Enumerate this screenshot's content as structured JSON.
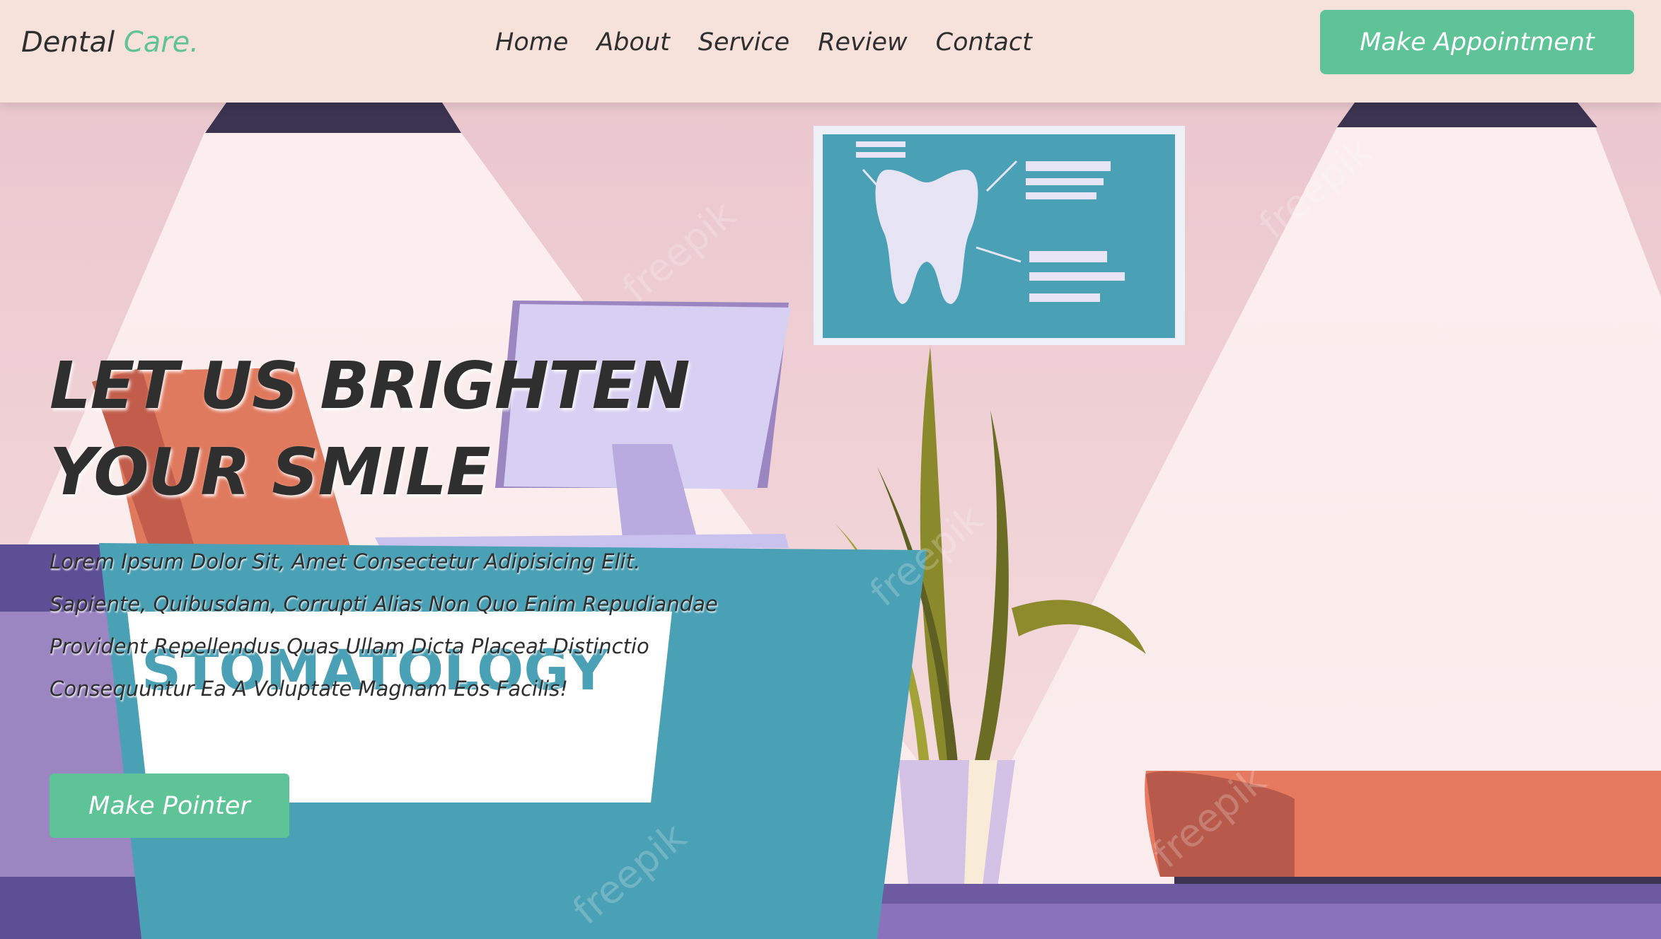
{
  "header": {
    "logo_primary": "Dental",
    "logo_accent": "Care.",
    "nav": [
      "Home",
      "About",
      "Service",
      "Review",
      "Contact"
    ],
    "cta_label": "Make Appointment"
  },
  "hero": {
    "title_line1": "LET US BRIGHTEN",
    "title_line2": "YOUR SMILE",
    "description": "Lorem Ipsum Dolor Sit, Amet Consectetur Adipisicing Elit. Sapiente, Quibusdam, Corrupti Alias Non Quo Enim Repudiandae Provident Repellendus Quas Ullam Dicta Placeat Distinctio Consequuntur Ea A Voluptate Magnam Eos Facilis!",
    "button_label": "Make Pointer"
  },
  "illustration": {
    "desk_sign": "STOMATOLOGY",
    "watermark": "freepik"
  },
  "colors": {
    "accent": "#5ec397",
    "header_bg": "#f7e2db",
    "text": "#2f2f2f"
  }
}
